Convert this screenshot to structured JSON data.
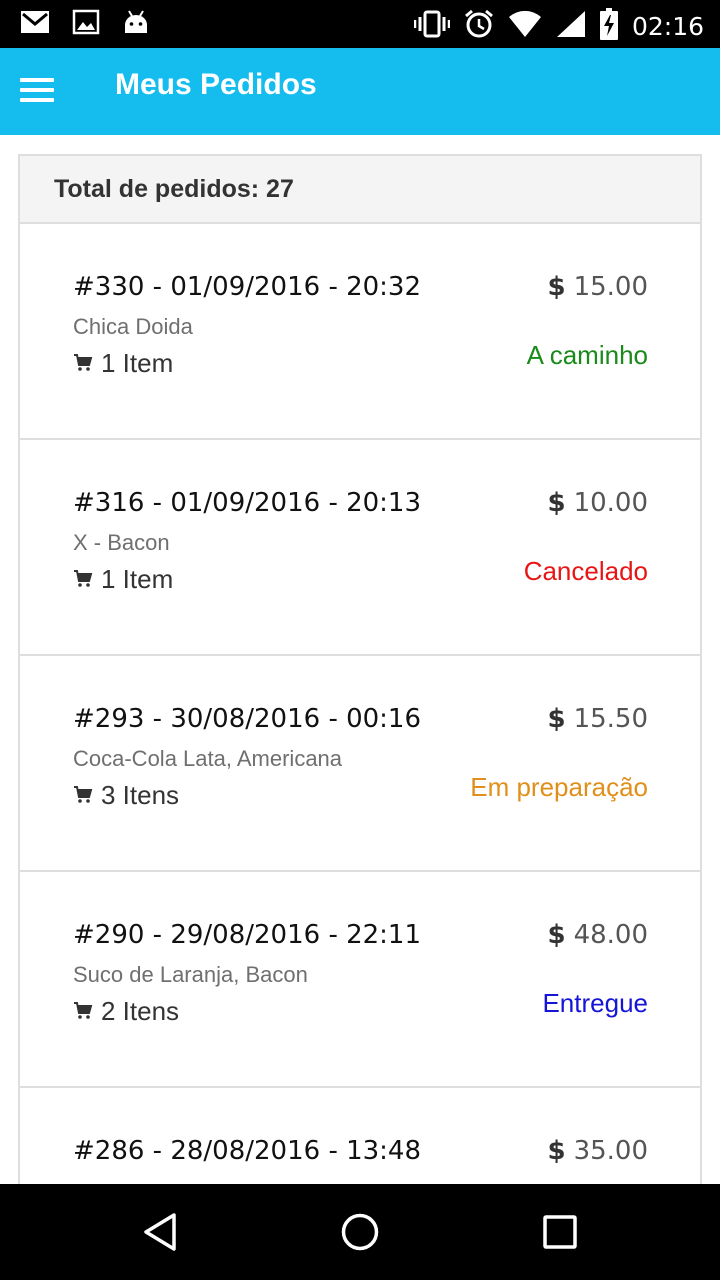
{
  "status_bar": {
    "time": "02:16",
    "left_icons": [
      "gmail-icon",
      "gallery-icon",
      "android-icon"
    ],
    "right_icons": [
      "vibrate-icon",
      "alarm-icon",
      "wifi-icon",
      "signal-icon",
      "battery-charging-icon"
    ]
  },
  "app_bar": {
    "title": "Meus Pedidos",
    "menu_icon": "menu-icon"
  },
  "orders_header": {
    "total_label": "Total de pedidos: 27"
  },
  "orders": [
    {
      "title": "#330 - 01/09/2016 - 20:32",
      "items": "Chica Doida",
      "count": "1 Item",
      "currency": "$",
      "price": "15.00",
      "status": "A caminho",
      "status_color": "#1a8a1a"
    },
    {
      "title": "#316 - 01/09/2016 - 20:13",
      "items": "X - Bacon",
      "count": "1 Item",
      "currency": "$",
      "price": "10.00",
      "status": "Cancelado",
      "status_color": "#e81515"
    },
    {
      "title": "#293 - 30/08/2016 - 00:16",
      "items": "Coca-Cola Lata, Americana",
      "count": "3 Itens",
      "currency": "$",
      "price": "15.50",
      "status": "Em preparação",
      "status_color": "#e0901a"
    },
    {
      "title": "#290 - 29/08/2016 - 22:11",
      "items": "Suco de Laranja, Bacon",
      "count": "2 Itens",
      "currency": "$",
      "price": "48.00",
      "status": "Entregue",
      "status_color": "#1515d8"
    },
    {
      "title": "#286 - 28/08/2016 - 13:48",
      "items": "",
      "count": "",
      "currency": "$",
      "price": "35.00",
      "status": "",
      "status_color": "#333333"
    }
  ],
  "nav_bar": {
    "buttons": [
      "back-icon",
      "home-icon",
      "recents-icon"
    ]
  },
  "colors": {
    "accent": "#15BDEF",
    "status_bar": "#000000",
    "nav_bar": "#000000"
  }
}
